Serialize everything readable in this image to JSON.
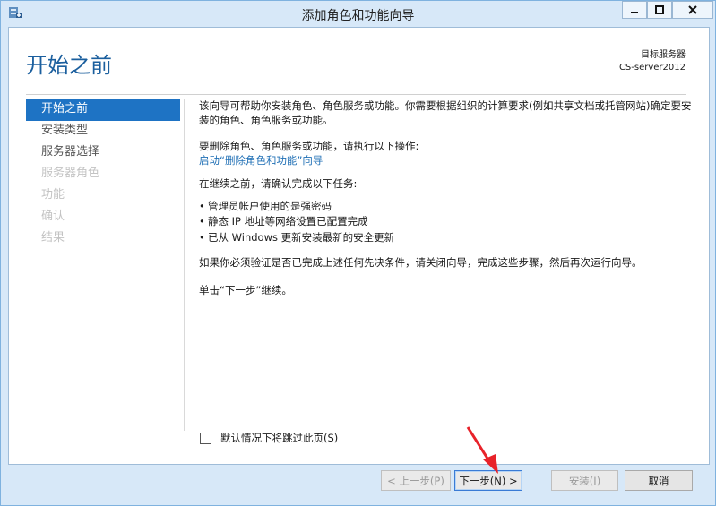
{
  "window": {
    "title": "添加角色和功能向导"
  },
  "header": {
    "page_title": "开始之前",
    "server_label": "目标服务器",
    "server_name": "CS-server2012"
  },
  "nav": {
    "items": [
      {
        "label": "开始之前",
        "state": "active"
      },
      {
        "label": "安装类型",
        "state": "normal"
      },
      {
        "label": "服务器选择",
        "state": "normal"
      },
      {
        "label": "服务器角色",
        "state": "disabled"
      },
      {
        "label": "功能",
        "state": "disabled"
      },
      {
        "label": "确认",
        "state": "disabled"
      },
      {
        "label": "结果",
        "state": "disabled"
      }
    ]
  },
  "main": {
    "intro": "该向导可帮助你安装角色、角色服务或功能。你需要根据组织的计算要求(例如共享文档或托管网站)确定要安装的角色、角色服务或功能。",
    "remove_text": "要删除角色、角色服务或功能，请执行以下操作:",
    "remove_link": "启动“删除角色和功能”向导",
    "before_text": "在继续之前，请确认完成以下任务:",
    "tasks": [
      "管理员帐户使用的是强密码",
      "静态 IP 地址等网络设置已配置完成",
      "已从 Windows 更新安装最新的安全更新"
    ],
    "verify_text": "如果你必须验证是否已完成上述任何先决条件，请关闭向导，完成这些步骤，然后再次运行向导。",
    "continue_text": "单击“下一步”继续。",
    "skip_label": "默认情况下将跳过此页(S)"
  },
  "footer": {
    "prev_label": "< 上一步(P)",
    "next_label": "下一步(N) >",
    "install_label": "安装(I)",
    "cancel_label": "取消"
  },
  "colors": {
    "accent": "#1e73c4",
    "title": "#1b5f9e",
    "link": "#1f6fb5",
    "arrow": "#e8222a"
  }
}
